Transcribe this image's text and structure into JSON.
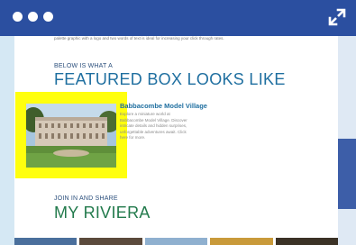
{
  "window": {
    "controls": [
      "dot-1",
      "dot-2",
      "dot-3"
    ],
    "expand_icon": "expand-diagonal-icon",
    "accent_color": "#2b4fa0"
  },
  "content": {
    "intro_text": "palette graphic with a logo and two words of text is ideal for increasing your click through rates.",
    "featured": {
      "label": "BELOW IS WHAT A",
      "heading": "FEATURED BOX LOOKS LIKE",
      "highlight_color": "#ffff0e",
      "card_title": "Babbacombe Model Village",
      "card_desc": "Explore a miniature world at Babbacombe Model Village. Discover intricate details and hidden surprises, unforgettable adventures await. Click here for more."
    },
    "riviera": {
      "label": "JOIN IN AND SHARE",
      "heading": "MY RIVIERA"
    },
    "thumb_colors": [
      "#4a6f9c",
      "#5b4a3c",
      "#8fb0cf",
      "#c99a3a",
      "#3b3226"
    ]
  }
}
